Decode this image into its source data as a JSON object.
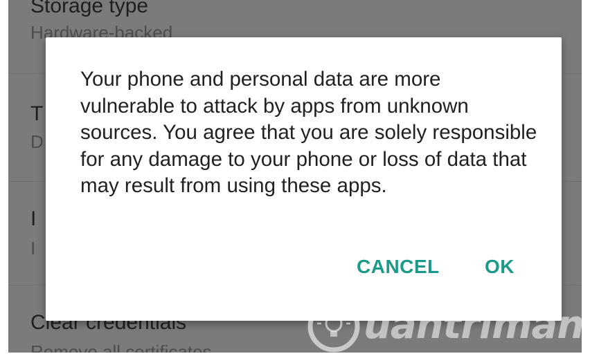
{
  "background_settings": {
    "items": [
      {
        "title": "Storage type",
        "summary": "Hardware-backed"
      },
      {
        "title": "T",
        "summary": "D"
      },
      {
        "title": "I",
        "summary": "I"
      },
      {
        "title": "Clear credentials",
        "summary": "Remove all certificates"
      }
    ]
  },
  "dialog": {
    "message": "Your phone and personal data are more vulnerable to attack by apps from unknown sources. You agree that you are solely responsible for any damage to your phone or loss of data that may result from using these apps.",
    "cancel_label": "CANCEL",
    "ok_label": "OK",
    "accent_color": "#1a9a88"
  },
  "watermark": {
    "text": "uantrimang",
    "logo_icon": "lightbulb-icon"
  }
}
